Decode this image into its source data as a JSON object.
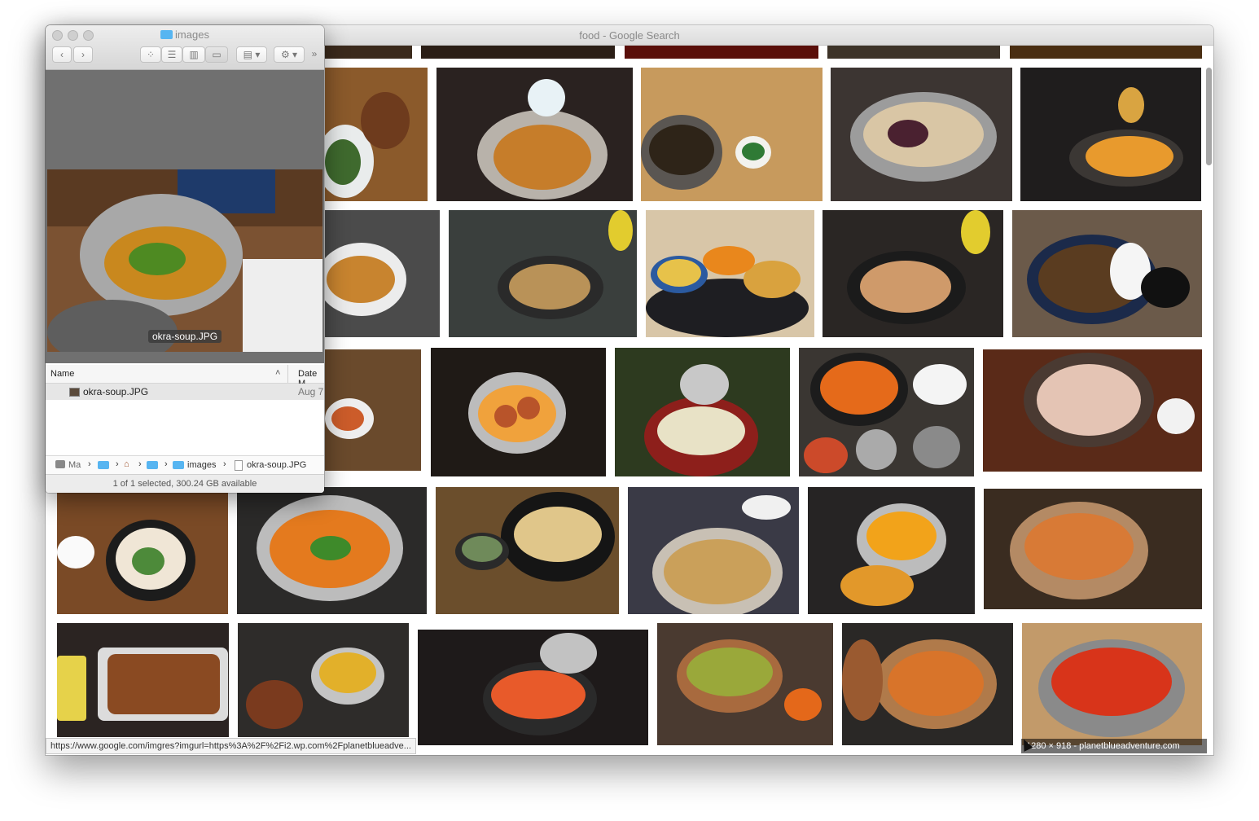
{
  "browser": {
    "title": "food - Google Search",
    "status_url": "https://www.google.com/imgres?imgurl=https%3A%2F%2Fi2.wp.com%2Fplanetblueadve...",
    "hover_caption": "1280 × 918 - planetblueadventure.com"
  },
  "finder": {
    "title": "images",
    "preview_filename": "okra-soup.JPG",
    "columns": {
      "name": "Name",
      "date": "Date M"
    },
    "files": [
      {
        "name": "okra-soup.JPG",
        "date": "Aug 7"
      }
    ],
    "path": [
      "Ma",
      "images",
      "okra-soup.JPG"
    ],
    "status": "1 of 1 selected, 300.24 GB available",
    "toolbar_icons": [
      "back-icon",
      "forward-icon",
      "icon-view-icon",
      "list-view-icon",
      "column-view-icon",
      "gallery-view-icon",
      "arrange-icon",
      "gear-icon",
      "more-icon"
    ]
  },
  "colors": {
    "folder_blue": "#57b5f1",
    "preview_gray": "#707070"
  }
}
